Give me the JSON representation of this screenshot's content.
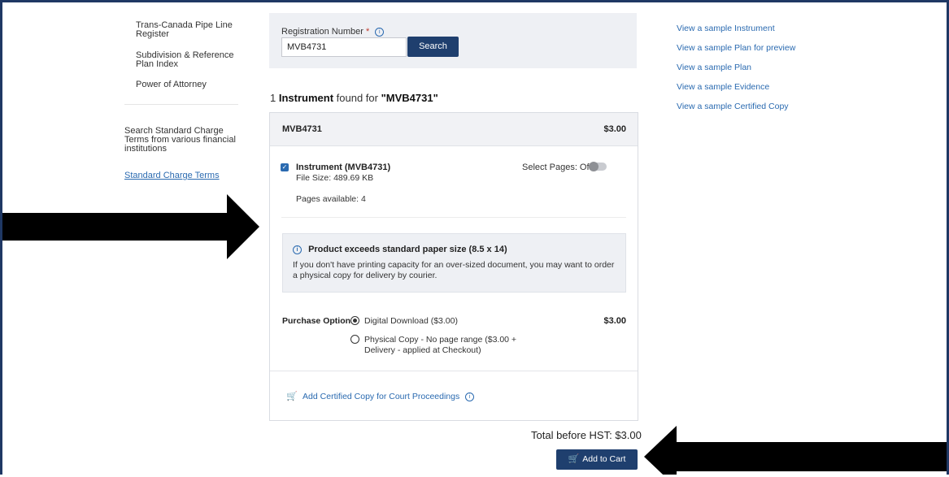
{
  "sidebar": {
    "items": [
      "Trans-Canada Pipe Line Register",
      "Subdivision & Reference Plan Index",
      "Power of Attorney"
    ],
    "description": "Search Standard Charge Terms from various financial institutions",
    "link": "Standard Charge Terms"
  },
  "search": {
    "label": "Registration Number",
    "required_mark": "*",
    "value": "MVB4731",
    "button": "Search"
  },
  "right_links": [
    "View a sample Instrument",
    "View a sample Plan for preview",
    "View a sample Plan",
    "View a sample Evidence",
    "View a sample Certified Copy"
  ],
  "results": {
    "count_text": "1",
    "type_text": "Instrument",
    "found_text": "found for",
    "query": "\"MVB4731\""
  },
  "card": {
    "id": "MVB4731",
    "price": "$3.00",
    "instrument_name": "Instrument (MVB4731)",
    "file_size": "File Size: 489.69 KB",
    "pages_available": "Pages available: 4",
    "select_pages": "Select Pages: Off",
    "notice_title": "Product exceeds standard paper size (8.5 x 14)",
    "notice_text": "If you don't have printing capacity for an over-sized document, you may want to order a physical copy for delivery by courier.",
    "purchase_label": "Purchase Options",
    "option_digital": "Digital Download ($3.00)",
    "option_physical": "Physical Copy - No page range ($3.00 + Delivery - applied at Checkout)",
    "option_price": "$3.00",
    "certified_link": "Add Certified Copy for Court Proceedings"
  },
  "total": "Total before HST: $3.00",
  "add_to_cart": "Add to Cart",
  "colors": {
    "primary": "#1f3f6e",
    "link": "#2a6ab0",
    "frame": "#1f3864"
  },
  "icons": [
    "info-icon",
    "cart-icon",
    "checkbox-icon"
  ]
}
